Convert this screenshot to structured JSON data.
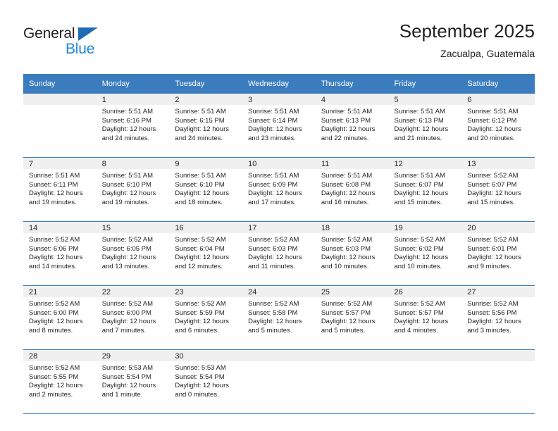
{
  "brand": {
    "name_part1": "General",
    "name_part2": "Blue",
    "triangle_color": "#1f6cb5",
    "blue_color": "#1e87d6"
  },
  "header": {
    "title": "September 2025",
    "subtitle": "Zacualpa, Guatemala"
  },
  "colors": {
    "header_blue": "#3a7cbe",
    "daynum_band": "#f0f0f0",
    "text": "#231f20"
  },
  "weekday_headers": [
    "Sunday",
    "Monday",
    "Tuesday",
    "Wednesday",
    "Thursday",
    "Friday",
    "Saturday"
  ],
  "weeks": [
    [
      {
        "day": "",
        "sunrise": "",
        "sunset": "",
        "daylight1": "",
        "daylight2": ""
      },
      {
        "day": "1",
        "sunrise": "Sunrise: 5:51 AM",
        "sunset": "Sunset: 6:16 PM",
        "daylight1": "Daylight: 12 hours",
        "daylight2": "and 24 minutes."
      },
      {
        "day": "2",
        "sunrise": "Sunrise: 5:51 AM",
        "sunset": "Sunset: 6:15 PM",
        "daylight1": "Daylight: 12 hours",
        "daylight2": "and 24 minutes."
      },
      {
        "day": "3",
        "sunrise": "Sunrise: 5:51 AM",
        "sunset": "Sunset: 6:14 PM",
        "daylight1": "Daylight: 12 hours",
        "daylight2": "and 23 minutes."
      },
      {
        "day": "4",
        "sunrise": "Sunrise: 5:51 AM",
        "sunset": "Sunset: 6:13 PM",
        "daylight1": "Daylight: 12 hours",
        "daylight2": "and 22 minutes."
      },
      {
        "day": "5",
        "sunrise": "Sunrise: 5:51 AM",
        "sunset": "Sunset: 6:13 PM",
        "daylight1": "Daylight: 12 hours",
        "daylight2": "and 21 minutes."
      },
      {
        "day": "6",
        "sunrise": "Sunrise: 5:51 AM",
        "sunset": "Sunset: 6:12 PM",
        "daylight1": "Daylight: 12 hours",
        "daylight2": "and 20 minutes."
      }
    ],
    [
      {
        "day": "7",
        "sunrise": "Sunrise: 5:51 AM",
        "sunset": "Sunset: 6:11 PM",
        "daylight1": "Daylight: 12 hours",
        "daylight2": "and 19 minutes."
      },
      {
        "day": "8",
        "sunrise": "Sunrise: 5:51 AM",
        "sunset": "Sunset: 6:10 PM",
        "daylight1": "Daylight: 12 hours",
        "daylight2": "and 19 minutes."
      },
      {
        "day": "9",
        "sunrise": "Sunrise: 5:51 AM",
        "sunset": "Sunset: 6:10 PM",
        "daylight1": "Daylight: 12 hours",
        "daylight2": "and 18 minutes."
      },
      {
        "day": "10",
        "sunrise": "Sunrise: 5:51 AM",
        "sunset": "Sunset: 6:09 PM",
        "daylight1": "Daylight: 12 hours",
        "daylight2": "and 17 minutes."
      },
      {
        "day": "11",
        "sunrise": "Sunrise: 5:51 AM",
        "sunset": "Sunset: 6:08 PM",
        "daylight1": "Daylight: 12 hours",
        "daylight2": "and 16 minutes."
      },
      {
        "day": "12",
        "sunrise": "Sunrise: 5:51 AM",
        "sunset": "Sunset: 6:07 PM",
        "daylight1": "Daylight: 12 hours",
        "daylight2": "and 15 minutes."
      },
      {
        "day": "13",
        "sunrise": "Sunrise: 5:52 AM",
        "sunset": "Sunset: 6:07 PM",
        "daylight1": "Daylight: 12 hours",
        "daylight2": "and 15 minutes."
      }
    ],
    [
      {
        "day": "14",
        "sunrise": "Sunrise: 5:52 AM",
        "sunset": "Sunset: 6:06 PM",
        "daylight1": "Daylight: 12 hours",
        "daylight2": "and 14 minutes."
      },
      {
        "day": "15",
        "sunrise": "Sunrise: 5:52 AM",
        "sunset": "Sunset: 6:05 PM",
        "daylight1": "Daylight: 12 hours",
        "daylight2": "and 13 minutes."
      },
      {
        "day": "16",
        "sunrise": "Sunrise: 5:52 AM",
        "sunset": "Sunset: 6:04 PM",
        "daylight1": "Daylight: 12 hours",
        "daylight2": "and 12 minutes."
      },
      {
        "day": "17",
        "sunrise": "Sunrise: 5:52 AM",
        "sunset": "Sunset: 6:03 PM",
        "daylight1": "Daylight: 12 hours",
        "daylight2": "and 11 minutes."
      },
      {
        "day": "18",
        "sunrise": "Sunrise: 5:52 AM",
        "sunset": "Sunset: 6:03 PM",
        "daylight1": "Daylight: 12 hours",
        "daylight2": "and 10 minutes."
      },
      {
        "day": "19",
        "sunrise": "Sunrise: 5:52 AM",
        "sunset": "Sunset: 6:02 PM",
        "daylight1": "Daylight: 12 hours",
        "daylight2": "and 10 minutes."
      },
      {
        "day": "20",
        "sunrise": "Sunrise: 5:52 AM",
        "sunset": "Sunset: 6:01 PM",
        "daylight1": "Daylight: 12 hours",
        "daylight2": "and 9 minutes."
      }
    ],
    [
      {
        "day": "21",
        "sunrise": "Sunrise: 5:52 AM",
        "sunset": "Sunset: 6:00 PM",
        "daylight1": "Daylight: 12 hours",
        "daylight2": "and 8 minutes."
      },
      {
        "day": "22",
        "sunrise": "Sunrise: 5:52 AM",
        "sunset": "Sunset: 6:00 PM",
        "daylight1": "Daylight: 12 hours",
        "daylight2": "and 7 minutes."
      },
      {
        "day": "23",
        "sunrise": "Sunrise: 5:52 AM",
        "sunset": "Sunset: 5:59 PM",
        "daylight1": "Daylight: 12 hours",
        "daylight2": "and 6 minutes."
      },
      {
        "day": "24",
        "sunrise": "Sunrise: 5:52 AM",
        "sunset": "Sunset: 5:58 PM",
        "daylight1": "Daylight: 12 hours",
        "daylight2": "and 5 minutes."
      },
      {
        "day": "25",
        "sunrise": "Sunrise: 5:52 AM",
        "sunset": "Sunset: 5:57 PM",
        "daylight1": "Daylight: 12 hours",
        "daylight2": "and 5 minutes."
      },
      {
        "day": "26",
        "sunrise": "Sunrise: 5:52 AM",
        "sunset": "Sunset: 5:57 PM",
        "daylight1": "Daylight: 12 hours",
        "daylight2": "and 4 minutes."
      },
      {
        "day": "27",
        "sunrise": "Sunrise: 5:52 AM",
        "sunset": "Sunset: 5:56 PM",
        "daylight1": "Daylight: 12 hours",
        "daylight2": "and 3 minutes."
      }
    ],
    [
      {
        "day": "28",
        "sunrise": "Sunrise: 5:52 AM",
        "sunset": "Sunset: 5:55 PM",
        "daylight1": "Daylight: 12 hours",
        "daylight2": "and 2 minutes."
      },
      {
        "day": "29",
        "sunrise": "Sunrise: 5:53 AM",
        "sunset": "Sunset: 5:54 PM",
        "daylight1": "Daylight: 12 hours",
        "daylight2": "and 1 minute."
      },
      {
        "day": "30",
        "sunrise": "Sunrise: 5:53 AM",
        "sunset": "Sunset: 5:54 PM",
        "daylight1": "Daylight: 12 hours",
        "daylight2": "and 0 minutes."
      },
      {
        "day": "",
        "sunrise": "",
        "sunset": "",
        "daylight1": "",
        "daylight2": ""
      },
      {
        "day": "",
        "sunrise": "",
        "sunset": "",
        "daylight1": "",
        "daylight2": ""
      },
      {
        "day": "",
        "sunrise": "",
        "sunset": "",
        "daylight1": "",
        "daylight2": ""
      },
      {
        "day": "",
        "sunrise": "",
        "sunset": "",
        "daylight1": "",
        "daylight2": ""
      }
    ]
  ]
}
